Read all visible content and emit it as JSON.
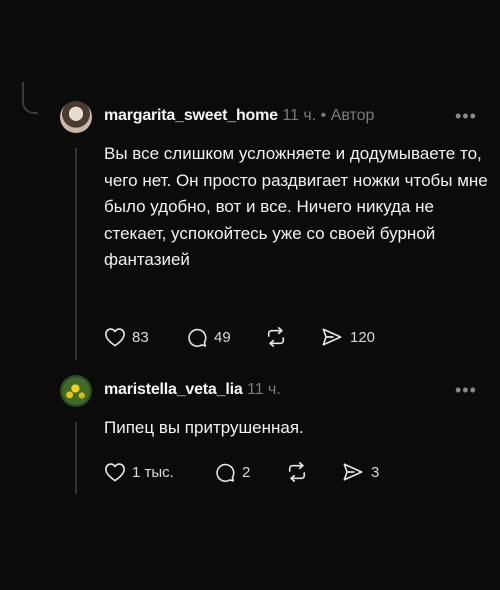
{
  "comments": [
    {
      "username": "margarita_sweet_home",
      "time": "11 ч.",
      "separator": "•",
      "badge": "Автор",
      "more": "•••",
      "text": "Вы все слишком усложняете и додумываете то, чего нет. Он просто раздвигает ножки чтобы мне было удобно, вот и все. Ничего никуда не стекает, успокойтесь уже со своей бурной фантазией",
      "actions": {
        "likes": "83",
        "replies": "49",
        "repost_icon": "repost-icon",
        "shares": "120"
      }
    },
    {
      "username": "maristella_veta_lia",
      "time": "11 ч.",
      "more": "•••",
      "text": "Пипец вы притрушенная.",
      "actions": {
        "likes": "1 тыс.",
        "replies": "2",
        "repost_icon": "repost-icon",
        "shares": "3"
      }
    }
  ],
  "colors": {
    "background": "#0b0b0c",
    "muted": "#7b7b7b",
    "thread_line": "#343434"
  }
}
